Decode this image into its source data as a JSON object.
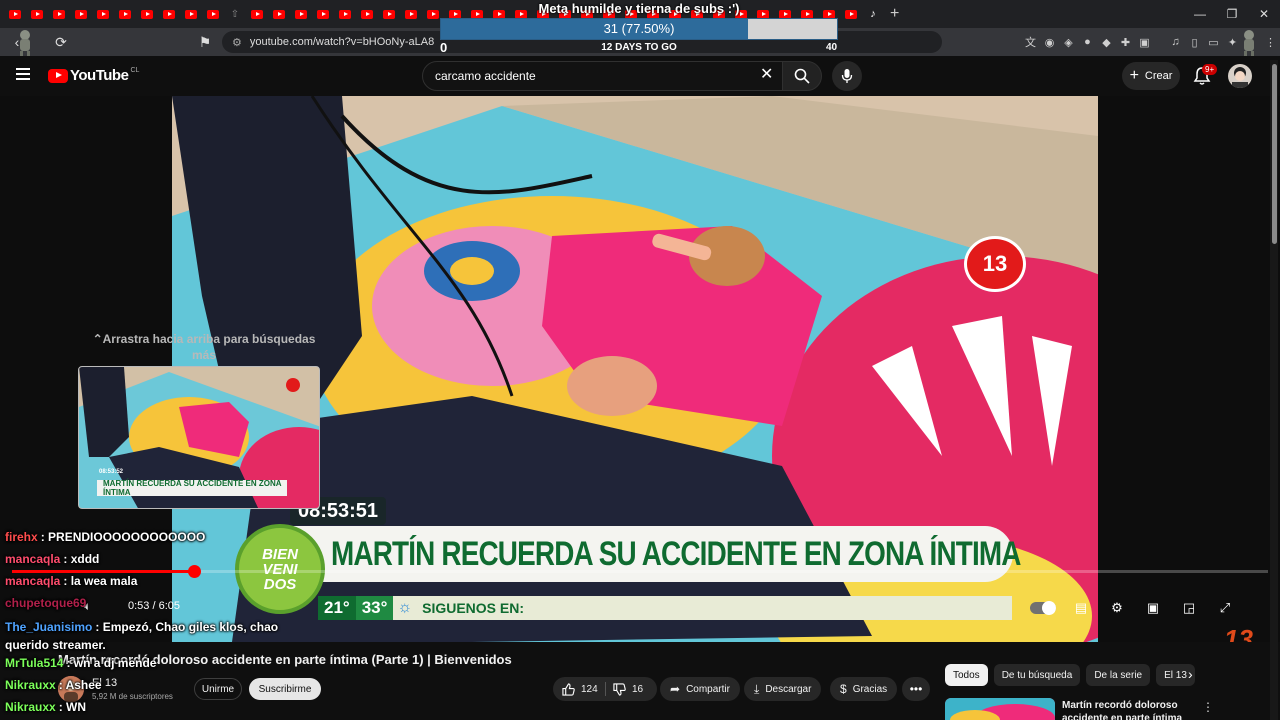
{
  "browser": {
    "url": "youtube.com/watch?v=bHOoNy-aLA8",
    "tab_count": 40
  },
  "goal": {
    "title": "Meta humilde y tierna de subs :')",
    "count_text": "31 (77.50%)",
    "progress_fraction": 0.775,
    "days_text": "12 DAYS TO GO",
    "min": "0",
    "max": "40"
  },
  "youtube": {
    "logo_text": "YouTube",
    "country_code": "CL",
    "search_value": "carcamo accidente",
    "create_label": "Crear",
    "notifications_badge": "9+"
  },
  "video": {
    "clock_overlay": "08:53:51",
    "lower_third_headline": "MARTÍN RECUERDA SU ACCIDENTE EN ZONA ÍNTIMA",
    "show_logo_line1": "BIEN",
    "show_logo_line2": "VENI",
    "show_logo_line3": "DOS",
    "temp_min": "21°",
    "temp_max": "33°",
    "follow_text": "SIGUENOS EN:",
    "channel_bug": "13",
    "watermark": "13",
    "current_time": "0:53",
    "duration": "6:05",
    "time_display": "0:53 / 6:05",
    "progress_fraction": 0.145,
    "drag_hint_line1": "Arrastra hacia arriba para búsquedas más",
    "drag_hint_line2": "precisas",
    "preview_caption": "MARTÍN RECUERDA SU ACCIDENTE EN ZONA ÍNTIMA",
    "preview_clock": "08:53:52"
  },
  "meta": {
    "title": "Martín recordó doloroso accidente en parte íntima (Parte 1) | Bienvenidos",
    "channel_name": "El 13",
    "subscribers": "5,92 M de suscriptores",
    "join_label": "Unirme",
    "subscribe_label": "Suscribirme",
    "likes": "124",
    "dislikes": "16",
    "share_label": "Compartir",
    "download_label": "Descargar",
    "thanks_label": "Gracias"
  },
  "related": {
    "chips": [
      "Todos",
      "De tu búsqueda",
      "De la serie",
      "El 13"
    ],
    "first_title": "Martín recordó doloroso accidente en parte íntima (Par"
  },
  "chat": [
    {
      "user": "firehx",
      "color": "#ff4d4d",
      "text": ": PRENDIOOOOOOOOOOOO"
    },
    {
      "user": "mancaqla",
      "color": "#ff4d6d",
      "text": ": xddd"
    },
    {
      "user": "mancaqla",
      "color": "#ff4d6d",
      "text": ": la wea mala"
    },
    {
      "user": "chupetoque69",
      "color": "#b0204a",
      "text": ""
    },
    {
      "user": "The_Juanisimo",
      "color": "#4fa3ff",
      "text": ": Empezó, Chao giles klos, chao querido streamer."
    },
    {
      "user": "MrTula514",
      "color": "#7cff5a",
      "text": ": wn a dj mende"
    },
    {
      "user": "Nikrauxx",
      "color": "#7cff5a",
      "text": ": Ashee"
    },
    {
      "user": "Nikrauxx",
      "color": "#7cff5a",
      "text": ": WN"
    }
  ],
  "colors": {
    "accent_red": "#ff0000",
    "goal_fill": "#2d6b9b",
    "show_green": "#0f6b30"
  }
}
